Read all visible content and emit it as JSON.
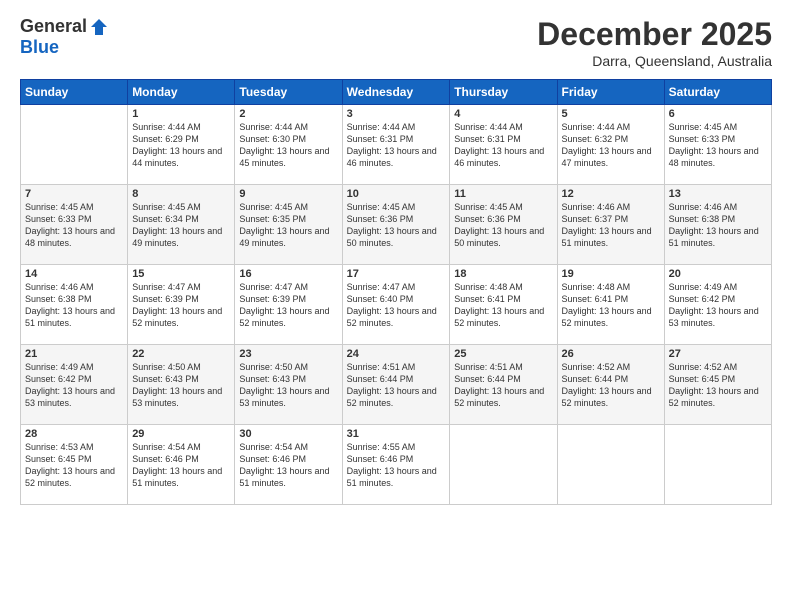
{
  "header": {
    "logo_general": "General",
    "logo_blue": "Blue",
    "month_title": "December 2025",
    "location": "Darra, Queensland, Australia"
  },
  "days_of_week": [
    "Sunday",
    "Monday",
    "Tuesday",
    "Wednesday",
    "Thursday",
    "Friday",
    "Saturday"
  ],
  "weeks": [
    [
      {
        "day": "",
        "sunrise": "",
        "sunset": "",
        "daylight": ""
      },
      {
        "day": "1",
        "sunrise": "Sunrise: 4:44 AM",
        "sunset": "Sunset: 6:29 PM",
        "daylight": "Daylight: 13 hours and 44 minutes."
      },
      {
        "day": "2",
        "sunrise": "Sunrise: 4:44 AM",
        "sunset": "Sunset: 6:30 PM",
        "daylight": "Daylight: 13 hours and 45 minutes."
      },
      {
        "day": "3",
        "sunrise": "Sunrise: 4:44 AM",
        "sunset": "Sunset: 6:31 PM",
        "daylight": "Daylight: 13 hours and 46 minutes."
      },
      {
        "day": "4",
        "sunrise": "Sunrise: 4:44 AM",
        "sunset": "Sunset: 6:31 PM",
        "daylight": "Daylight: 13 hours and 46 minutes."
      },
      {
        "day": "5",
        "sunrise": "Sunrise: 4:44 AM",
        "sunset": "Sunset: 6:32 PM",
        "daylight": "Daylight: 13 hours and 47 minutes."
      },
      {
        "day": "6",
        "sunrise": "Sunrise: 4:45 AM",
        "sunset": "Sunset: 6:33 PM",
        "daylight": "Daylight: 13 hours and 48 minutes."
      }
    ],
    [
      {
        "day": "7",
        "sunrise": "Sunrise: 4:45 AM",
        "sunset": "Sunset: 6:33 PM",
        "daylight": "Daylight: 13 hours and 48 minutes."
      },
      {
        "day": "8",
        "sunrise": "Sunrise: 4:45 AM",
        "sunset": "Sunset: 6:34 PM",
        "daylight": "Daylight: 13 hours and 49 minutes."
      },
      {
        "day": "9",
        "sunrise": "Sunrise: 4:45 AM",
        "sunset": "Sunset: 6:35 PM",
        "daylight": "Daylight: 13 hours and 49 minutes."
      },
      {
        "day": "10",
        "sunrise": "Sunrise: 4:45 AM",
        "sunset": "Sunset: 6:36 PM",
        "daylight": "Daylight: 13 hours and 50 minutes."
      },
      {
        "day": "11",
        "sunrise": "Sunrise: 4:45 AM",
        "sunset": "Sunset: 6:36 PM",
        "daylight": "Daylight: 13 hours and 50 minutes."
      },
      {
        "day": "12",
        "sunrise": "Sunrise: 4:46 AM",
        "sunset": "Sunset: 6:37 PM",
        "daylight": "Daylight: 13 hours and 51 minutes."
      },
      {
        "day": "13",
        "sunrise": "Sunrise: 4:46 AM",
        "sunset": "Sunset: 6:38 PM",
        "daylight": "Daylight: 13 hours and 51 minutes."
      }
    ],
    [
      {
        "day": "14",
        "sunrise": "Sunrise: 4:46 AM",
        "sunset": "Sunset: 6:38 PM",
        "daylight": "Daylight: 13 hours and 51 minutes."
      },
      {
        "day": "15",
        "sunrise": "Sunrise: 4:47 AM",
        "sunset": "Sunset: 6:39 PM",
        "daylight": "Daylight: 13 hours and 52 minutes."
      },
      {
        "day": "16",
        "sunrise": "Sunrise: 4:47 AM",
        "sunset": "Sunset: 6:39 PM",
        "daylight": "Daylight: 13 hours and 52 minutes."
      },
      {
        "day": "17",
        "sunrise": "Sunrise: 4:47 AM",
        "sunset": "Sunset: 6:40 PM",
        "daylight": "Daylight: 13 hours and 52 minutes."
      },
      {
        "day": "18",
        "sunrise": "Sunrise: 4:48 AM",
        "sunset": "Sunset: 6:41 PM",
        "daylight": "Daylight: 13 hours and 52 minutes."
      },
      {
        "day": "19",
        "sunrise": "Sunrise: 4:48 AM",
        "sunset": "Sunset: 6:41 PM",
        "daylight": "Daylight: 13 hours and 52 minutes."
      },
      {
        "day": "20",
        "sunrise": "Sunrise: 4:49 AM",
        "sunset": "Sunset: 6:42 PM",
        "daylight": "Daylight: 13 hours and 53 minutes."
      }
    ],
    [
      {
        "day": "21",
        "sunrise": "Sunrise: 4:49 AM",
        "sunset": "Sunset: 6:42 PM",
        "daylight": "Daylight: 13 hours and 53 minutes."
      },
      {
        "day": "22",
        "sunrise": "Sunrise: 4:50 AM",
        "sunset": "Sunset: 6:43 PM",
        "daylight": "Daylight: 13 hours and 53 minutes."
      },
      {
        "day": "23",
        "sunrise": "Sunrise: 4:50 AM",
        "sunset": "Sunset: 6:43 PM",
        "daylight": "Daylight: 13 hours and 53 minutes."
      },
      {
        "day": "24",
        "sunrise": "Sunrise: 4:51 AM",
        "sunset": "Sunset: 6:44 PM",
        "daylight": "Daylight: 13 hours and 52 minutes."
      },
      {
        "day": "25",
        "sunrise": "Sunrise: 4:51 AM",
        "sunset": "Sunset: 6:44 PM",
        "daylight": "Daylight: 13 hours and 52 minutes."
      },
      {
        "day": "26",
        "sunrise": "Sunrise: 4:52 AM",
        "sunset": "Sunset: 6:44 PM",
        "daylight": "Daylight: 13 hours and 52 minutes."
      },
      {
        "day": "27",
        "sunrise": "Sunrise: 4:52 AM",
        "sunset": "Sunset: 6:45 PM",
        "daylight": "Daylight: 13 hours and 52 minutes."
      }
    ],
    [
      {
        "day": "28",
        "sunrise": "Sunrise: 4:53 AM",
        "sunset": "Sunset: 6:45 PM",
        "daylight": "Daylight: 13 hours and 52 minutes."
      },
      {
        "day": "29",
        "sunrise": "Sunrise: 4:54 AM",
        "sunset": "Sunset: 6:46 PM",
        "daylight": "Daylight: 13 hours and 51 minutes."
      },
      {
        "day": "30",
        "sunrise": "Sunrise: 4:54 AM",
        "sunset": "Sunset: 6:46 PM",
        "daylight": "Daylight: 13 hours and 51 minutes."
      },
      {
        "day": "31",
        "sunrise": "Sunrise: 4:55 AM",
        "sunset": "Sunset: 6:46 PM",
        "daylight": "Daylight: 13 hours and 51 minutes."
      },
      {
        "day": "",
        "sunrise": "",
        "sunset": "",
        "daylight": ""
      },
      {
        "day": "",
        "sunrise": "",
        "sunset": "",
        "daylight": ""
      },
      {
        "day": "",
        "sunrise": "",
        "sunset": "",
        "daylight": ""
      }
    ]
  ]
}
